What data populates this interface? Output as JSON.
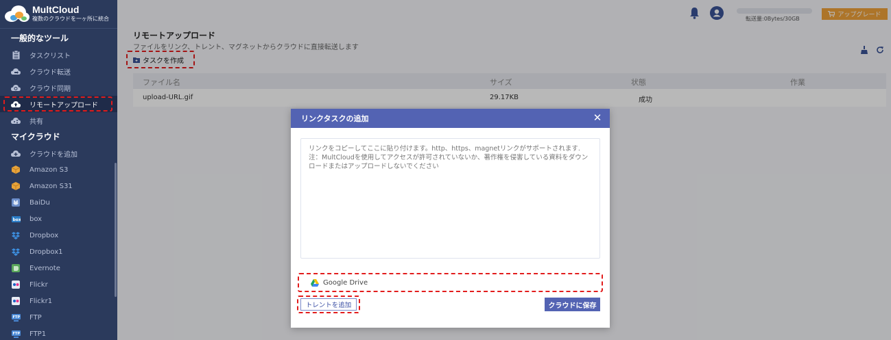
{
  "app": {
    "name": "MultCloud",
    "tagline": "複数のクラウドを一ヶ所に統合"
  },
  "sidebar": {
    "section_tools": "一般的なツール",
    "tools": [
      {
        "label": "タスクリスト",
        "icon": "clipboard-icon"
      },
      {
        "label": "クラウド転送",
        "icon": "cloud-transfer-icon"
      },
      {
        "label": "クラウド同期",
        "icon": "cloud-sync-icon"
      },
      {
        "label": "リモートアップロード",
        "icon": "cloud-upload-icon",
        "active": true
      },
      {
        "label": "共有",
        "icon": "cloud-share-icon"
      }
    ],
    "section_clouds": "マイクラウド",
    "clouds": [
      {
        "label": "クラウドを追加",
        "icon": "cloud-add-icon"
      },
      {
        "label": "Amazon S3",
        "icon": "amazon-s3-icon"
      },
      {
        "label": "Amazon S31",
        "icon": "amazon-s3-icon"
      },
      {
        "label": "BaiDu",
        "icon": "baidu-icon"
      },
      {
        "label": "box",
        "icon": "box-icon"
      },
      {
        "label": "Dropbox",
        "icon": "dropbox-icon"
      },
      {
        "label": "Dropbox1",
        "icon": "dropbox-icon"
      },
      {
        "label": "Evernote",
        "icon": "evernote-icon"
      },
      {
        "label": "Flickr",
        "icon": "flickr-icon"
      },
      {
        "label": "Flickr1",
        "icon": "flickr-icon"
      },
      {
        "label": "FTP",
        "icon": "ftp-icon"
      },
      {
        "label": "FTP1",
        "icon": "ftp-icon"
      }
    ]
  },
  "topbar": {
    "quota": "転送量:0Bytes/30GB",
    "upgrade": "アップグレード"
  },
  "main": {
    "title": "リモートアップロード",
    "subtitle": "ファイルをリンク、トレント、マグネットからクラウドに直接転送します",
    "create_task": "タスクを作成",
    "columns": [
      "ファイル名",
      "サイズ",
      "状態",
      "作業"
    ],
    "rows": [
      {
        "name": "upload-URL.gif",
        "size": "29.17KB",
        "status": "成功",
        "action": ""
      }
    ]
  },
  "modal": {
    "title": "リンクタスクの追加",
    "placeholder": "リンクをコピーしてここに貼り付けます。http、https、magnetリンクがサポートされます.\n注：MultCloudを使用してアクセスが許可されていないか、著作権を侵害している資料をダウンロードまたはアップロードしないでください",
    "destination": "Google Drive",
    "add_torrent": "トレントを追加",
    "save": "クラウドに保存"
  },
  "colors": {
    "sidebar_bg": "#2b3a5c",
    "accent": "#5363b3",
    "upgrade": "#f0a23b",
    "highlight": "#e21c1c"
  }
}
